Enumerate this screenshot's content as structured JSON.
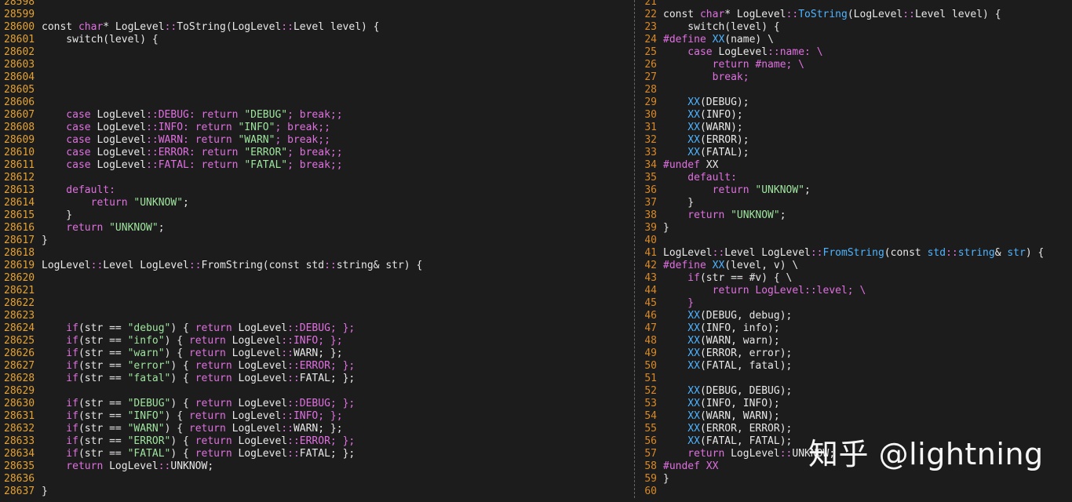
{
  "colors": {
    "background": "#1c1c1c",
    "line_number": "#e3a233",
    "keyword": "#e070e0",
    "string": "#9fe59f",
    "function": "#4fb4ff",
    "text": "#e8e8e8"
  },
  "watermark": "知乎 @lightning",
  "left_pane": {
    "lines": [
      {
        "n": "28598",
        "t": []
      },
      {
        "n": "28599",
        "t": []
      },
      {
        "n": "28600",
        "t": [
          [
            "p",
            "const "
          ],
          [
            "k",
            "char"
          ],
          [
            "p",
            "* LogLevel"
          ],
          [
            "k",
            "::"
          ],
          [
            "p",
            "ToString(LogLevel"
          ],
          [
            "k",
            "::"
          ],
          [
            "p",
            "Level level) {"
          ]
        ]
      },
      {
        "n": "28601",
        "t": [
          [
            "p",
            "    switch(level) {"
          ]
        ]
      },
      {
        "n": "28602",
        "t": []
      },
      {
        "n": "28603",
        "t": []
      },
      {
        "n": "28604",
        "t": []
      },
      {
        "n": "28605",
        "t": []
      },
      {
        "n": "28606",
        "t": []
      },
      {
        "n": "28607",
        "t": [
          [
            "k",
            "    case "
          ],
          [
            "p",
            "LogLevel"
          ],
          [
            "k",
            "::"
          ],
          [
            "k",
            "DEBUG: return "
          ],
          [
            "s",
            "\"DEBUG\""
          ],
          [
            "k",
            "; break;;"
          ]
        ]
      },
      {
        "n": "28608",
        "t": [
          [
            "k",
            "    case "
          ],
          [
            "p",
            "LogLevel"
          ],
          [
            "k",
            "::"
          ],
          [
            "k",
            "INFO: return "
          ],
          [
            "s",
            "\"INFO\""
          ],
          [
            "k",
            "; break;;"
          ]
        ]
      },
      {
        "n": "28609",
        "t": [
          [
            "k",
            "    case "
          ],
          [
            "p",
            "LogLevel"
          ],
          [
            "k",
            "::"
          ],
          [
            "k",
            "WARN: return "
          ],
          [
            "s",
            "\"WARN\""
          ],
          [
            "k",
            "; break;;"
          ]
        ]
      },
      {
        "n": "28610",
        "t": [
          [
            "k",
            "    case "
          ],
          [
            "p",
            "LogLevel"
          ],
          [
            "k",
            "::"
          ],
          [
            "k",
            "ERROR: return "
          ],
          [
            "s",
            "\"ERROR\""
          ],
          [
            "k",
            "; break;;"
          ]
        ]
      },
      {
        "n": "28611",
        "t": [
          [
            "k",
            "    case "
          ],
          [
            "p",
            "LogLevel"
          ],
          [
            "k",
            "::"
          ],
          [
            "k",
            "FATAL: return "
          ],
          [
            "s",
            "\"FATAL\""
          ],
          [
            "k",
            "; break;;"
          ]
        ]
      },
      {
        "n": "28612",
        "t": []
      },
      {
        "n": "28613",
        "t": [
          [
            "k",
            "    default:"
          ]
        ]
      },
      {
        "n": "28614",
        "t": [
          [
            "k",
            "        return "
          ],
          [
            "s",
            "\"UNKNOW\""
          ],
          [
            "p",
            ";"
          ]
        ]
      },
      {
        "n": "28615",
        "t": [
          [
            "p",
            "    }"
          ]
        ]
      },
      {
        "n": "28616",
        "t": [
          [
            "k",
            "    return "
          ],
          [
            "s",
            "\"UNKNOW\""
          ],
          [
            "p",
            ";"
          ]
        ]
      },
      {
        "n": "28617",
        "t": [
          [
            "p",
            "}"
          ]
        ]
      },
      {
        "n": "28618",
        "t": []
      },
      {
        "n": "28619",
        "t": [
          [
            "p",
            "LogLevel"
          ],
          [
            "k",
            "::"
          ],
          [
            "p",
            "Level LogLevel"
          ],
          [
            "k",
            "::"
          ],
          [
            "p",
            "FromString(const std"
          ],
          [
            "k",
            "::"
          ],
          [
            "p",
            "string& str) {"
          ]
        ]
      },
      {
        "n": "28620",
        "t": []
      },
      {
        "n": "28621",
        "t": []
      },
      {
        "n": "28622",
        "t": []
      },
      {
        "n": "28623",
        "t": []
      },
      {
        "n": "28624",
        "t": [
          [
            "k",
            "    if"
          ],
          [
            "p",
            "(str == "
          ],
          [
            "s",
            "\"debug\""
          ],
          [
            "p",
            ") { "
          ],
          [
            "k",
            "return "
          ],
          [
            "p",
            "LogLevel"
          ],
          [
            "k",
            "::"
          ],
          [
            "k",
            "DEBUG; };"
          ]
        ]
      },
      {
        "n": "28625",
        "t": [
          [
            "k",
            "    if"
          ],
          [
            "p",
            "(str == "
          ],
          [
            "s",
            "\"info\""
          ],
          [
            "p",
            ") { "
          ],
          [
            "k",
            "return "
          ],
          [
            "p",
            "LogLevel"
          ],
          [
            "k",
            "::"
          ],
          [
            "k",
            "INFO; };"
          ]
        ]
      },
      {
        "n": "28626",
        "t": [
          [
            "k",
            "    if"
          ],
          [
            "p",
            "(str == "
          ],
          [
            "s",
            "\"warn\""
          ],
          [
            "p",
            ") { "
          ],
          [
            "k",
            "return "
          ],
          [
            "p",
            "LogLevel"
          ],
          [
            "k",
            "::"
          ],
          [
            "p",
            "WARN; };"
          ]
        ]
      },
      {
        "n": "28627",
        "t": [
          [
            "k",
            "    if"
          ],
          [
            "p",
            "(str == "
          ],
          [
            "s",
            "\"error\""
          ],
          [
            "p",
            ") { "
          ],
          [
            "k",
            "return "
          ],
          [
            "p",
            "LogLevel"
          ],
          [
            "k",
            "::"
          ],
          [
            "k",
            "ERROR; };"
          ]
        ]
      },
      {
        "n": "28628",
        "t": [
          [
            "k",
            "    if"
          ],
          [
            "p",
            "(str == "
          ],
          [
            "s",
            "\"fatal\""
          ],
          [
            "p",
            ") { "
          ],
          [
            "k",
            "return "
          ],
          [
            "p",
            "LogLevel"
          ],
          [
            "k",
            "::"
          ],
          [
            "p",
            "FATAL; };"
          ]
        ]
      },
      {
        "n": "28629",
        "t": []
      },
      {
        "n": "28630",
        "t": [
          [
            "k",
            "    if"
          ],
          [
            "p",
            "(str == "
          ],
          [
            "s",
            "\"DEBUG\""
          ],
          [
            "p",
            ") { "
          ],
          [
            "k",
            "return "
          ],
          [
            "p",
            "LogLevel"
          ],
          [
            "k",
            "::"
          ],
          [
            "k",
            "DEBUG; };"
          ]
        ]
      },
      {
        "n": "28631",
        "t": [
          [
            "k",
            "    if"
          ],
          [
            "p",
            "(str == "
          ],
          [
            "s",
            "\"INFO\""
          ],
          [
            "p",
            ") { "
          ],
          [
            "k",
            "return "
          ],
          [
            "p",
            "LogLevel"
          ],
          [
            "k",
            "::"
          ],
          [
            "k",
            "INFO; };"
          ]
        ]
      },
      {
        "n": "28632",
        "t": [
          [
            "k",
            "    if"
          ],
          [
            "p",
            "(str == "
          ],
          [
            "s",
            "\"WARN\""
          ],
          [
            "p",
            ") { "
          ],
          [
            "k",
            "return "
          ],
          [
            "p",
            "LogLevel"
          ],
          [
            "k",
            "::"
          ],
          [
            "p",
            "WARN; };"
          ]
        ]
      },
      {
        "n": "28633",
        "t": [
          [
            "k",
            "    if"
          ],
          [
            "p",
            "(str == "
          ],
          [
            "s",
            "\"ERROR\""
          ],
          [
            "p",
            ") { "
          ],
          [
            "k",
            "return "
          ],
          [
            "p",
            "LogLevel"
          ],
          [
            "k",
            "::"
          ],
          [
            "k",
            "ERROR; };"
          ]
        ]
      },
      {
        "n": "28634",
        "t": [
          [
            "k",
            "    if"
          ],
          [
            "p",
            "(str == "
          ],
          [
            "s",
            "\"FATAL\""
          ],
          [
            "p",
            ") { "
          ],
          [
            "k",
            "return "
          ],
          [
            "p",
            "LogLevel"
          ],
          [
            "k",
            "::"
          ],
          [
            "p",
            "FATAL; };"
          ]
        ]
      },
      {
        "n": "28635",
        "t": [
          [
            "k",
            "    return "
          ],
          [
            "p",
            "LogLevel"
          ],
          [
            "k",
            "::"
          ],
          [
            "p",
            "UNKNOW;"
          ]
        ]
      },
      {
        "n": "28636",
        "t": []
      },
      {
        "n": "28637",
        "t": [
          [
            "p",
            "}"
          ]
        ]
      }
    ]
  },
  "right_pane": {
    "lines": [
      {
        "n": "21",
        "t": []
      },
      {
        "n": "22",
        "t": [
          [
            "p",
            "const "
          ],
          [
            "k",
            "char"
          ],
          [
            "p",
            "* LogLevel"
          ],
          [
            "k",
            "::"
          ],
          [
            "f",
            "ToString"
          ],
          [
            "p",
            "(LogLevel"
          ],
          [
            "k",
            "::"
          ],
          [
            "p",
            "Level level) {"
          ]
        ]
      },
      {
        "n": "23",
        "t": [
          [
            "p",
            "    switch(level) {"
          ]
        ]
      },
      {
        "n": "24",
        "t": [
          [
            "k",
            "#define "
          ],
          [
            "f",
            "XX"
          ],
          [
            "p",
            "(name) \\"
          ]
        ]
      },
      {
        "n": "25",
        "t": [
          [
            "k",
            "    case "
          ],
          [
            "p",
            "LogLevel"
          ],
          [
            "k",
            "::"
          ],
          [
            "k",
            "name: \\"
          ]
        ]
      },
      {
        "n": "26",
        "t": [
          [
            "k",
            "        return #name; \\"
          ]
        ]
      },
      {
        "n": "27",
        "t": [
          [
            "k",
            "        break;"
          ]
        ]
      },
      {
        "n": "28",
        "t": []
      },
      {
        "n": "29",
        "t": [
          [
            "f",
            "    XX"
          ],
          [
            "p",
            "(DEBUG);"
          ]
        ]
      },
      {
        "n": "30",
        "t": [
          [
            "f",
            "    XX"
          ],
          [
            "p",
            "(INFO);"
          ]
        ]
      },
      {
        "n": "31",
        "t": [
          [
            "f",
            "    XX"
          ],
          [
            "p",
            "(WARN);"
          ]
        ]
      },
      {
        "n": "32",
        "t": [
          [
            "f",
            "    XX"
          ],
          [
            "p",
            "(ERROR);"
          ]
        ]
      },
      {
        "n": "33",
        "t": [
          [
            "f",
            "    XX"
          ],
          [
            "p",
            "(FATAL);"
          ]
        ]
      },
      {
        "n": "34",
        "t": [
          [
            "k",
            "#undef "
          ],
          [
            "p",
            "XX"
          ]
        ]
      },
      {
        "n": "35",
        "t": [
          [
            "k",
            "    default:"
          ]
        ]
      },
      {
        "n": "36",
        "t": [
          [
            "k",
            "        return "
          ],
          [
            "s",
            "\"UNKNOW\""
          ],
          [
            "p",
            ";"
          ]
        ]
      },
      {
        "n": "37",
        "t": [
          [
            "p",
            "    }"
          ]
        ]
      },
      {
        "n": "38",
        "t": [
          [
            "k",
            "    return "
          ],
          [
            "s",
            "\"UNKNOW\""
          ],
          [
            "p",
            ";"
          ]
        ]
      },
      {
        "n": "39",
        "t": [
          [
            "p",
            "}"
          ]
        ]
      },
      {
        "n": "40",
        "t": []
      },
      {
        "n": "41",
        "t": [
          [
            "p",
            "LogLevel"
          ],
          [
            "k",
            "::"
          ],
          [
            "p",
            "Level LogLevel"
          ],
          [
            "k",
            "::"
          ],
          [
            "f",
            "FromString"
          ],
          [
            "p",
            "(const "
          ],
          [
            "f",
            "std"
          ],
          [
            "k",
            "::"
          ],
          [
            "f",
            "string"
          ],
          [
            "p",
            "& "
          ],
          [
            "f",
            "str"
          ],
          [
            "p",
            ") {"
          ]
        ]
      },
      {
        "n": "42",
        "t": [
          [
            "k",
            "#define "
          ],
          [
            "f",
            "XX"
          ],
          [
            "p",
            "(level, v) \\"
          ]
        ]
      },
      {
        "n": "43",
        "t": [
          [
            "k",
            "    if"
          ],
          [
            "p",
            "(str == #v) { \\"
          ]
        ]
      },
      {
        "n": "44",
        "t": [
          [
            "k",
            "        return LogLevel"
          ],
          [
            "k",
            "::"
          ],
          [
            "k",
            "level; \\"
          ]
        ]
      },
      {
        "n": "45",
        "t": [
          [
            "k",
            "    }"
          ]
        ]
      },
      {
        "n": "46",
        "t": [
          [
            "f",
            "    XX"
          ],
          [
            "p",
            "(DEBUG, debug);"
          ]
        ]
      },
      {
        "n": "47",
        "t": [
          [
            "f",
            "    XX"
          ],
          [
            "p",
            "(INFO, info);"
          ]
        ]
      },
      {
        "n": "48",
        "t": [
          [
            "f",
            "    XX"
          ],
          [
            "p",
            "(WARN, warn);"
          ]
        ]
      },
      {
        "n": "49",
        "t": [
          [
            "f",
            "    XX"
          ],
          [
            "p",
            "(ERROR, error);"
          ]
        ]
      },
      {
        "n": "50",
        "t": [
          [
            "f",
            "    XX"
          ],
          [
            "p",
            "(FATAL, fatal);"
          ]
        ]
      },
      {
        "n": "51",
        "t": []
      },
      {
        "n": "52",
        "t": [
          [
            "f",
            "    XX"
          ],
          [
            "p",
            "(DEBUG, DEBUG);"
          ]
        ]
      },
      {
        "n": "53",
        "t": [
          [
            "f",
            "    XX"
          ],
          [
            "p",
            "(INFO, INFO);"
          ]
        ]
      },
      {
        "n": "54",
        "t": [
          [
            "f",
            "    XX"
          ],
          [
            "p",
            "(WARN, WARN);"
          ]
        ]
      },
      {
        "n": "55",
        "t": [
          [
            "f",
            "    XX"
          ],
          [
            "p",
            "(ERROR, ERROR);"
          ]
        ]
      },
      {
        "n": "56",
        "t": [
          [
            "f",
            "    XX"
          ],
          [
            "p",
            "(FATAL, FATAL);"
          ]
        ]
      },
      {
        "n": "57",
        "t": [
          [
            "k",
            "    return "
          ],
          [
            "p",
            "LogLevel"
          ],
          [
            "k",
            "::"
          ],
          [
            "p",
            "UNKNOW;"
          ]
        ]
      },
      {
        "n": "58",
        "t": [
          [
            "k",
            "#undef "
          ],
          [
            "k",
            "XX"
          ]
        ]
      },
      {
        "n": "59",
        "t": [
          [
            "p",
            "}"
          ]
        ]
      },
      {
        "n": "60",
        "t": []
      }
    ]
  }
}
